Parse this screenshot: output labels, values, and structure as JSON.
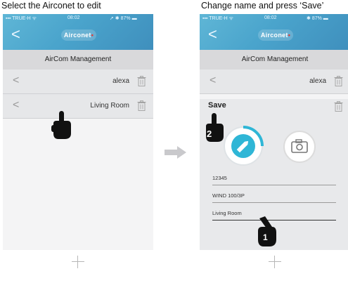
{
  "captions": {
    "left": "Select the Airconet to edit",
    "right": "Change name and press ‘Save’"
  },
  "status_bar": {
    "carrier": "TRUE-H",
    "time": "08:02",
    "battery": "87%"
  },
  "app": {
    "logo": "Airconet",
    "header": "AirCom Management",
    "back_glyph": "<",
    "add_icon": "plus-icon"
  },
  "left_screen": {
    "rows": [
      {
        "chevron": "<",
        "label": "alexa"
      },
      {
        "chevron": "<",
        "label": "Living Room"
      }
    ]
  },
  "right_screen": {
    "rows": [
      {
        "chevron": "<",
        "label": "alexa"
      }
    ],
    "save_label": "Save",
    "fields": [
      "12345",
      "WIND 100/3P",
      "Living Room"
    ],
    "step_badges": [
      "2",
      "1"
    ]
  },
  "colors": {
    "header_blue": "#4aa4cc",
    "accent_ring": "#2fb6d6",
    "logo_red": "#e53935"
  }
}
